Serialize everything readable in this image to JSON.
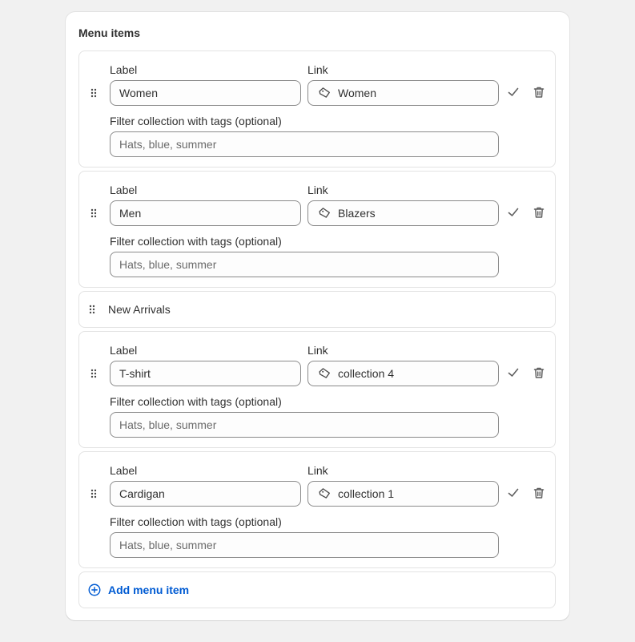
{
  "menu": {
    "title": "Menu items",
    "items": [
      {
        "kind": "expanded",
        "label_caption": "Label",
        "label_value": "Women",
        "link_caption": "Link",
        "link_value": "Women",
        "filter_caption": "Filter collection with tags (optional)",
        "filter_placeholder": "Hats, blue, summer"
      },
      {
        "kind": "expanded",
        "label_caption": "Label",
        "label_value": "Men",
        "link_caption": "Link",
        "link_value": "Blazers",
        "filter_caption": "Filter collection with tags (optional)",
        "filter_placeholder": "Hats, blue, summer"
      },
      {
        "kind": "collapsed",
        "title": "New Arrivals"
      },
      {
        "kind": "expanded",
        "label_caption": "Label",
        "label_value": "T-shirt",
        "link_caption": "Link",
        "link_value": "collection 4",
        "filter_caption": "Filter collection with tags (optional)",
        "filter_placeholder": "Hats, blue, summer"
      },
      {
        "kind": "expanded",
        "label_caption": "Label",
        "label_value": "Cardigan",
        "link_caption": "Link",
        "link_value": "collection 1",
        "filter_caption": "Filter collection with tags (optional)",
        "filter_placeholder": "Hats, blue, summer"
      }
    ],
    "add_label": "Add menu item"
  },
  "colors": {
    "accent": "#005bd3",
    "border": "#8a8a8a",
    "muted": "#6b6b6b",
    "background": "#f1f1f1"
  },
  "icons": {
    "drag": "drag-handle-icon",
    "link": "tag-icon",
    "confirm": "checkmark-icon",
    "delete": "trash-icon",
    "add": "plus-circle-icon"
  }
}
